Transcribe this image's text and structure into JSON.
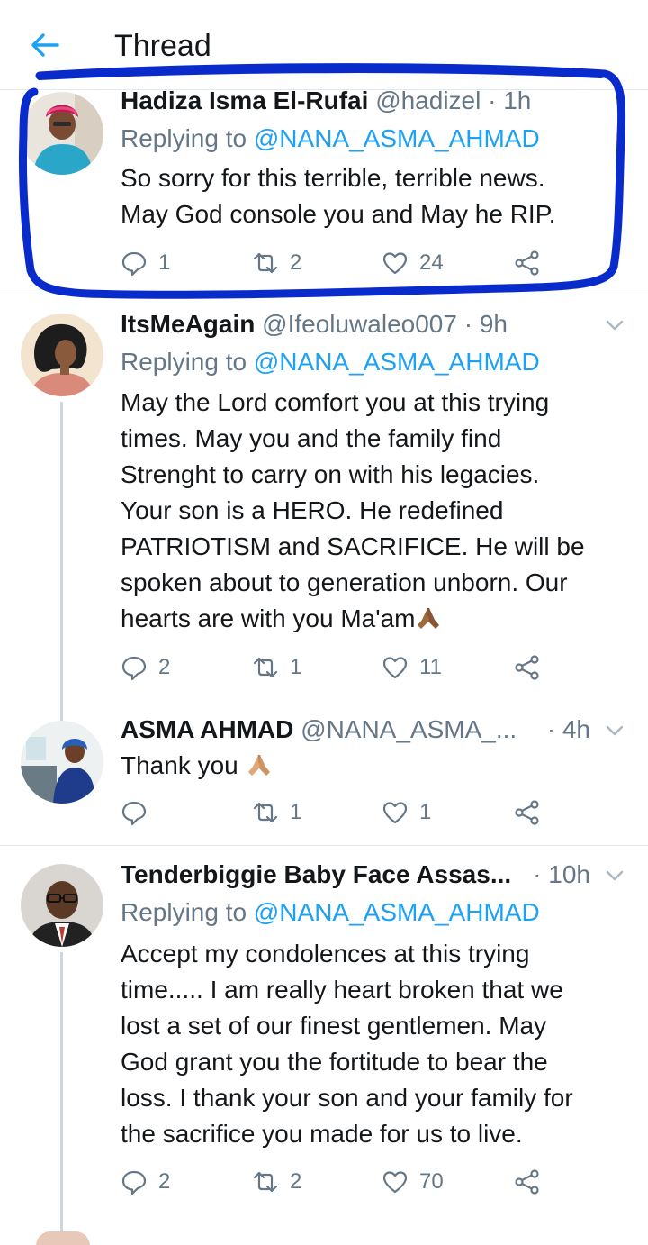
{
  "header": {
    "title": "Thread"
  },
  "colors": {
    "accent": "#1da1f2",
    "muted": "#657786",
    "highlight": "#0a2bcc",
    "text": "#14171a"
  },
  "tweets": [
    {
      "name": "Hadiza Isma El-Rufai",
      "handle": "@hadizel",
      "time": "· 1h",
      "replying_prefix": "Replying to",
      "replying_to": "@NANA_ASMA_AHMAD",
      "lines": [
        "So sorry for this terrible, terrible news.",
        "May God console you and May he RIP."
      ],
      "replies": "1",
      "retweets": "2",
      "likes": "24",
      "avatar_icon": "woman-headwrap-avatar"
    },
    {
      "name": "ItsMeAgain",
      "handle": "@Ifeoluwaleo007",
      "time": "· 9h",
      "replying_prefix": "Replying to",
      "replying_to": "@NANA_ASMA_AHMAD",
      "lines": [
        "May the Lord comfort you at this trying",
        "times. May you and the family find",
        "Strenght to carry on with his legacies.",
        "Your son is a HERO. He redefined",
        "PATRIOTISM and SACRIFICE. He will be",
        "spoken about to generation unborn. Our",
        "hearts are with you Ma'am"
      ],
      "replies": "2",
      "retweets": "1",
      "likes": "11",
      "avatar_icon": "illustrated-woman-avatar",
      "emoji": "folded-hands-icon"
    },
    {
      "name": "ASMA AHMAD",
      "handle": "@NANA_ASMA_...",
      "time": "· 4h",
      "lines": [
        "Thank you"
      ],
      "replies": "",
      "retweets": "1",
      "likes": "1",
      "avatar_icon": "woman-office-avatar",
      "emoji": "folded-hands-icon"
    },
    {
      "name": "Tenderbiggie Baby Face Assas...",
      "handle": "",
      "time": "· 10h",
      "replying_prefix": "Replying to",
      "replying_to": "@NANA_ASMA_AHMAD",
      "lines": [
        "Accept my condolences at this trying",
        "time..... I am really heart broken that we",
        "lost a set of our finest gentlemen. May",
        "God grant you the fortitude to bear the",
        "loss. I thank your son and your family for",
        "the sacrifice you made for us to live."
      ],
      "replies": "2",
      "retweets": "2",
      "likes": "70",
      "avatar_icon": "man-glasses-avatar"
    }
  ]
}
